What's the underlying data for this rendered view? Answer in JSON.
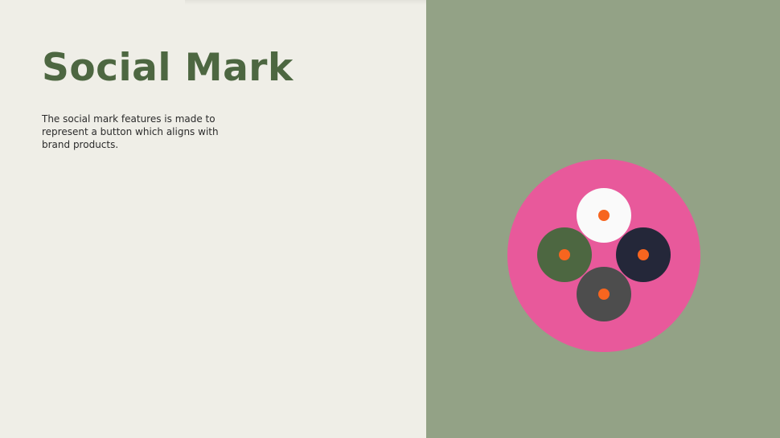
{
  "slide": {
    "title": "Social Mark",
    "description": "The social mark features is made to represent a button which aligns with brand products."
  },
  "colors": {
    "left_background": "#efeee7",
    "right_background": "#93a286",
    "title": "#4d6741",
    "mark_outer": "#e8599b",
    "mark_top": "#fafafa",
    "mark_left": "#4d6741",
    "mark_right": "#242739",
    "mark_bottom": "#4d4d4d",
    "dot": "#f7651f"
  },
  "mark": {
    "buttons": [
      {
        "name": "top-button",
        "color_key": "mark_top"
      },
      {
        "name": "left-button",
        "color_key": "mark_left"
      },
      {
        "name": "right-button",
        "color_key": "mark_right"
      },
      {
        "name": "bottom-button",
        "color_key": "mark_bottom"
      }
    ]
  }
}
